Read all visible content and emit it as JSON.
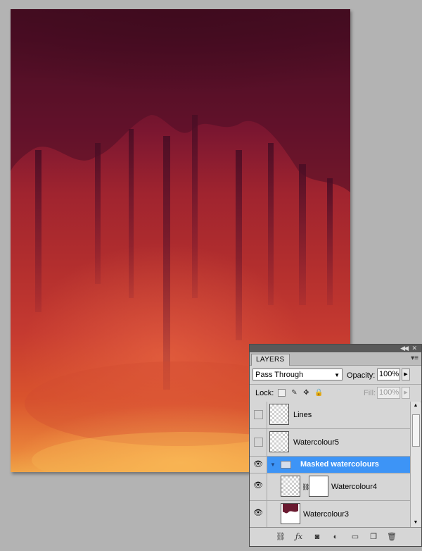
{
  "layers_panel": {
    "tab_label": "LAYERS",
    "blend_mode": "Pass Through",
    "opacity_label": "Opacity:",
    "opacity_value": "100%",
    "lock_label": "Lock:",
    "fill_label": "Fill:",
    "fill_value": "100%",
    "layers": [
      {
        "name": "Lines",
        "visible": false
      },
      {
        "name": "Watercolour5",
        "visible": false
      },
      {
        "name": "Masked watercolours",
        "visible": true,
        "type": "group",
        "selected": true
      },
      {
        "name": "Watercolour4",
        "visible": true,
        "has_mask": true
      },
      {
        "name": "Watercolour3",
        "visible": true
      }
    ],
    "footer_icons": [
      "link-layers-icon",
      "fx-icon",
      "add-mask-icon",
      "adjustment-layer-icon",
      "new-group-icon",
      "new-layer-icon",
      "trash-icon"
    ]
  },
  "colors": {
    "selection": "#3d94f6",
    "panel_bg": "#d6d6d6",
    "workspace_bg": "#b3b3b3"
  }
}
